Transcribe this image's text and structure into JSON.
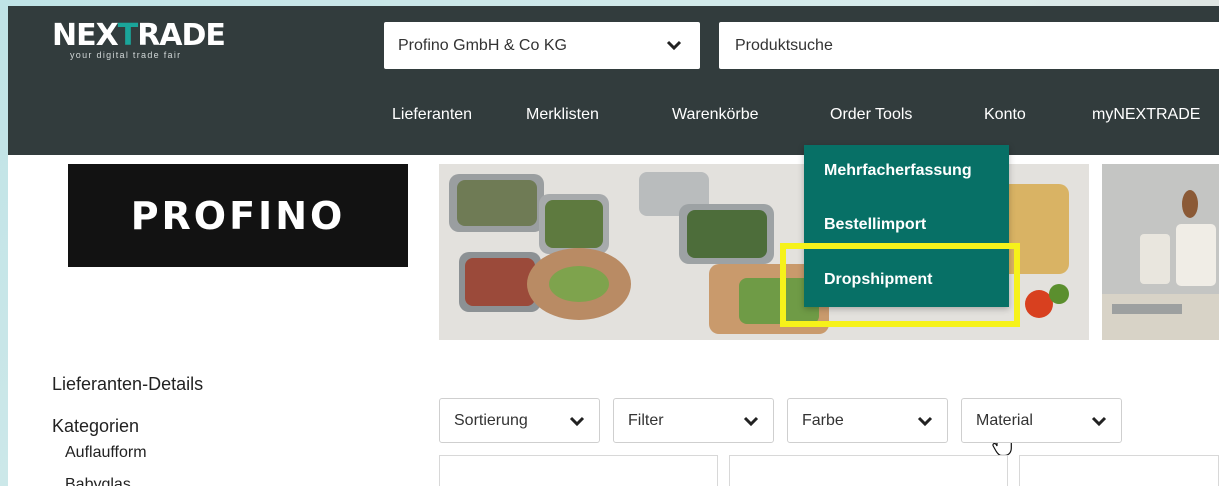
{
  "header": {
    "logo_text_a": "NEX",
    "logo_text_t": "T",
    "logo_text_b": "RADE",
    "logo_tagline": "your digital trade fair",
    "supplier_select": "Profino GmbH & Co KG",
    "search_placeholder": "Produktsuche"
  },
  "nav": [
    {
      "label": "Lieferanten"
    },
    {
      "label": "Merklisten"
    },
    {
      "label": "Warenkörbe"
    },
    {
      "label": "Order Tools"
    },
    {
      "label": "Konto"
    },
    {
      "label": "myNEXTRADE"
    }
  ],
  "order_tools_menu": [
    {
      "label": "Mehrfacherfassung"
    },
    {
      "label": "Bestellimport"
    },
    {
      "label": "Dropshipment"
    }
  ],
  "brand": {
    "name": "PROFINO"
  },
  "sidebar": {
    "details_label": "Lieferanten-Details",
    "categories_label": "Kategorien",
    "categories": [
      "Auflaufform",
      "Babyglas"
    ]
  },
  "filters": [
    {
      "label": "Sortierung"
    },
    {
      "label": "Filter"
    },
    {
      "label": "Farbe"
    },
    {
      "label": "Material"
    }
  ],
  "colors": {
    "header_bg": "#323c3d",
    "menu_bg": "#077066",
    "highlight": "#f6f21a",
    "logo_accent": "#1aa59a"
  }
}
